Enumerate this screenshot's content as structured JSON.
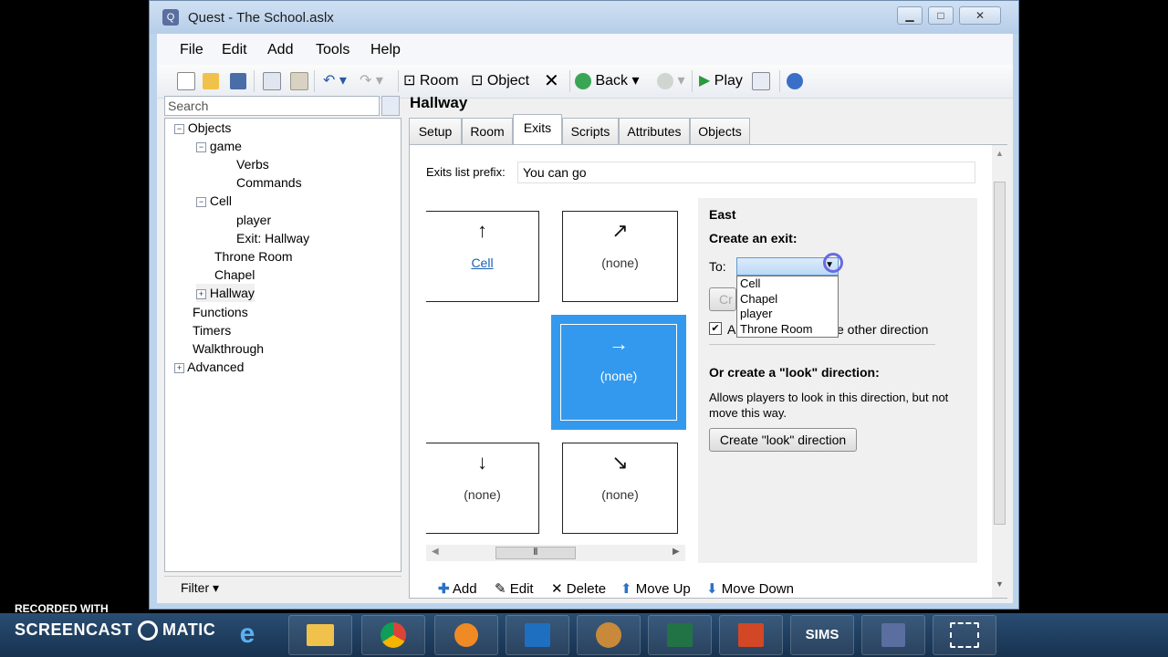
{
  "window": {
    "title": "Quest - The School.aslx",
    "app_icon": "Q"
  },
  "menu": [
    "File",
    "Edit",
    "Add",
    "Tools",
    "Help"
  ],
  "toolbar": {
    "room": "Room",
    "object": "Object",
    "back": "Back",
    "play": "Play"
  },
  "search": {
    "placeholder": "Search"
  },
  "tree": {
    "objects": "Objects",
    "game": "game",
    "verbs": "Verbs",
    "commands": "Commands",
    "cell": "Cell",
    "player": "player",
    "exit_hallway": "Exit: Hallway",
    "throne_room": "Throne Room",
    "chapel": "Chapel",
    "hallway": "Hallway",
    "functions": "Functions",
    "timers": "Timers",
    "walkthrough": "Walkthrough",
    "advanced": "Advanced",
    "filter": "Filter"
  },
  "editor": {
    "object_title": "Hallway",
    "tabs": [
      "Setup",
      "Room",
      "Exits",
      "Scripts",
      "Attributes",
      "Objects"
    ],
    "active_tab": "Exits",
    "exits_prefix_label": "Exits list prefix:",
    "exits_prefix_value": "You can go",
    "compass": {
      "north": {
        "arrow": "↑",
        "label": "Cell"
      },
      "northeast": {
        "arrow": "↗",
        "label": "(none)"
      },
      "east": {
        "arrow": "→",
        "label": "(none)"
      },
      "south": {
        "arrow": "↓",
        "label": "(none)"
      },
      "southeast": {
        "arrow": "↘",
        "label": "(none)"
      }
    },
    "side": {
      "direction": "East",
      "create_exit": "Create an exit:",
      "to_label": "To:",
      "dropdown_options": [
        "Cell",
        "Chapel",
        "player",
        "Throne Room"
      ],
      "create_button_fragment": "Cr",
      "checkbox_fragment_a": "A",
      "checkbox_fragment_b": "e other direction",
      "look_heading": "Or create a \"look\" direction:",
      "look_desc": "Allows players to look in this direction, but not move this way.",
      "look_button": "Create \"look\" direction"
    },
    "bottom": {
      "add": "Add",
      "edit": "Edit",
      "delete": "Delete",
      "move_up": "Move Up",
      "move_down": "Move Down"
    }
  },
  "overlay": {
    "recorded_with": "RECORDED WITH",
    "brand": "SCREENCAST",
    "brand_end": "MATIC"
  },
  "taskbar": {
    "sims": "SIMS"
  }
}
